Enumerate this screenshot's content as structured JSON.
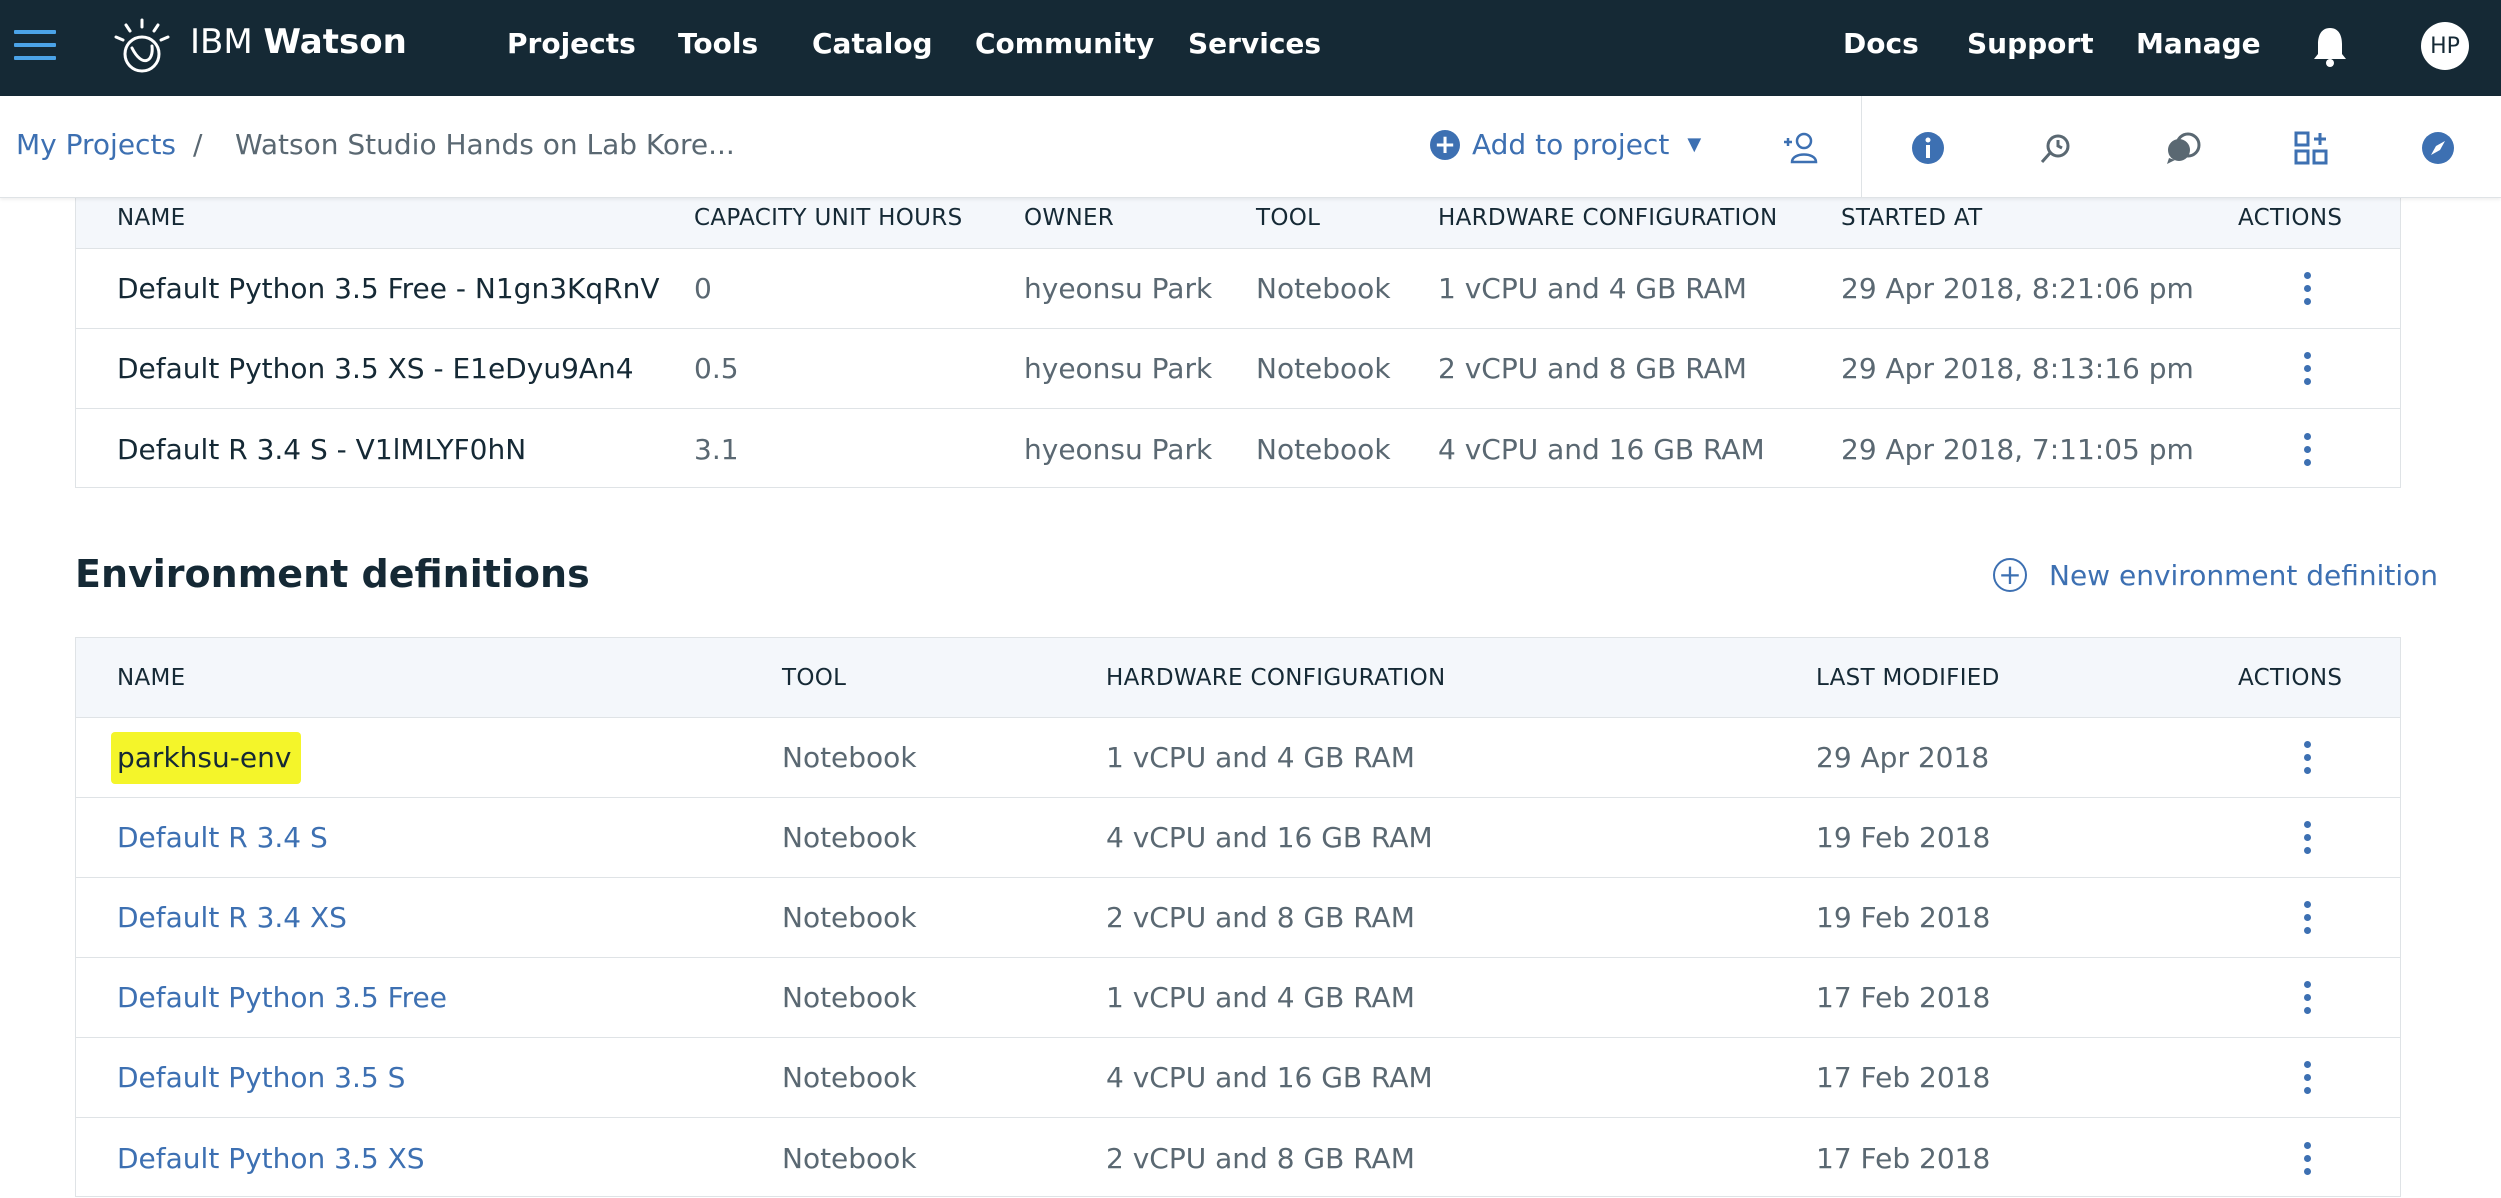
{
  "topnav": {
    "brand_prefix": "IBM",
    "brand_name": "Watson",
    "items": [
      "Projects",
      "Tools",
      "Catalog",
      "Community",
      "Services"
    ],
    "right_items": [
      "Docs",
      "Support",
      "Manage"
    ],
    "avatar_initials": "HP"
  },
  "breadcrumb": {
    "root": "My Projects",
    "separator": "/",
    "current": "Watson Studio Hands on Lab Kore..."
  },
  "toolbar": {
    "add_to_project": "Add to project"
  },
  "runtimes_table": {
    "headers": [
      "NAME",
      "CAPACITY UNIT HOURS",
      "OWNER",
      "TOOL",
      "HARDWARE CONFIGURATION",
      "STARTED AT",
      "ACTIONS"
    ],
    "rows": [
      {
        "name": "Default Python 3.5 Free - N1gn3KqRnV",
        "cuh": "0",
        "owner": "hyeonsu Park",
        "tool": "Notebook",
        "hardware": "1 vCPU and 4 GB RAM",
        "started": "29 Apr 2018, 8:21:06 pm"
      },
      {
        "name": "Default Python 3.5 XS - E1eDyu9An4",
        "cuh": "0.5",
        "owner": "hyeonsu Park",
        "tool": "Notebook",
        "hardware": "2 vCPU and 8 GB RAM",
        "started": "29 Apr 2018, 8:13:16 pm"
      },
      {
        "name": "Default R 3.4 S - V1lMLYF0hN",
        "cuh": "3.1",
        "owner": "hyeonsu Park",
        "tool": "Notebook",
        "hardware": "4 vCPU and 16 GB RAM",
        "started": "29 Apr 2018, 7:11:05 pm"
      }
    ]
  },
  "env_section": {
    "title": "Environment definitions",
    "new_button": "New environment definition"
  },
  "env_table": {
    "headers": [
      "NAME",
      "TOOL",
      "HARDWARE CONFIGURATION",
      "LAST MODIFIED",
      "ACTIONS"
    ],
    "rows": [
      {
        "name": "parkhsu-env",
        "tool": "Notebook",
        "hardware": "1 vCPU and 4 GB RAM",
        "modified": "29 Apr 2018"
      },
      {
        "name": "Default R 3.4 S",
        "tool": "Notebook",
        "hardware": "4 vCPU and 16 GB RAM",
        "modified": "19 Feb 2018"
      },
      {
        "name": "Default R 3.4 XS",
        "tool": "Notebook",
        "hardware": "2 vCPU and 8 GB RAM",
        "modified": "19 Feb 2018"
      },
      {
        "name": "Default Python 3.5 Free",
        "tool": "Notebook",
        "hardware": "1 vCPU and 4 GB RAM",
        "modified": "17 Feb 2018"
      },
      {
        "name": "Default Python 3.5 S",
        "tool": "Notebook",
        "hardware": "4 vCPU and 16 GB RAM",
        "modified": "17 Feb 2018"
      },
      {
        "name": "Default Python 3.5 XS",
        "tool": "Notebook",
        "hardware": "2 vCPU and 8 GB RAM",
        "modified": "17 Feb 2018"
      }
    ]
  },
  "colors": {
    "nav_bg": "#152935",
    "link": "#3d70b2",
    "highlight": "#f4f52a"
  }
}
